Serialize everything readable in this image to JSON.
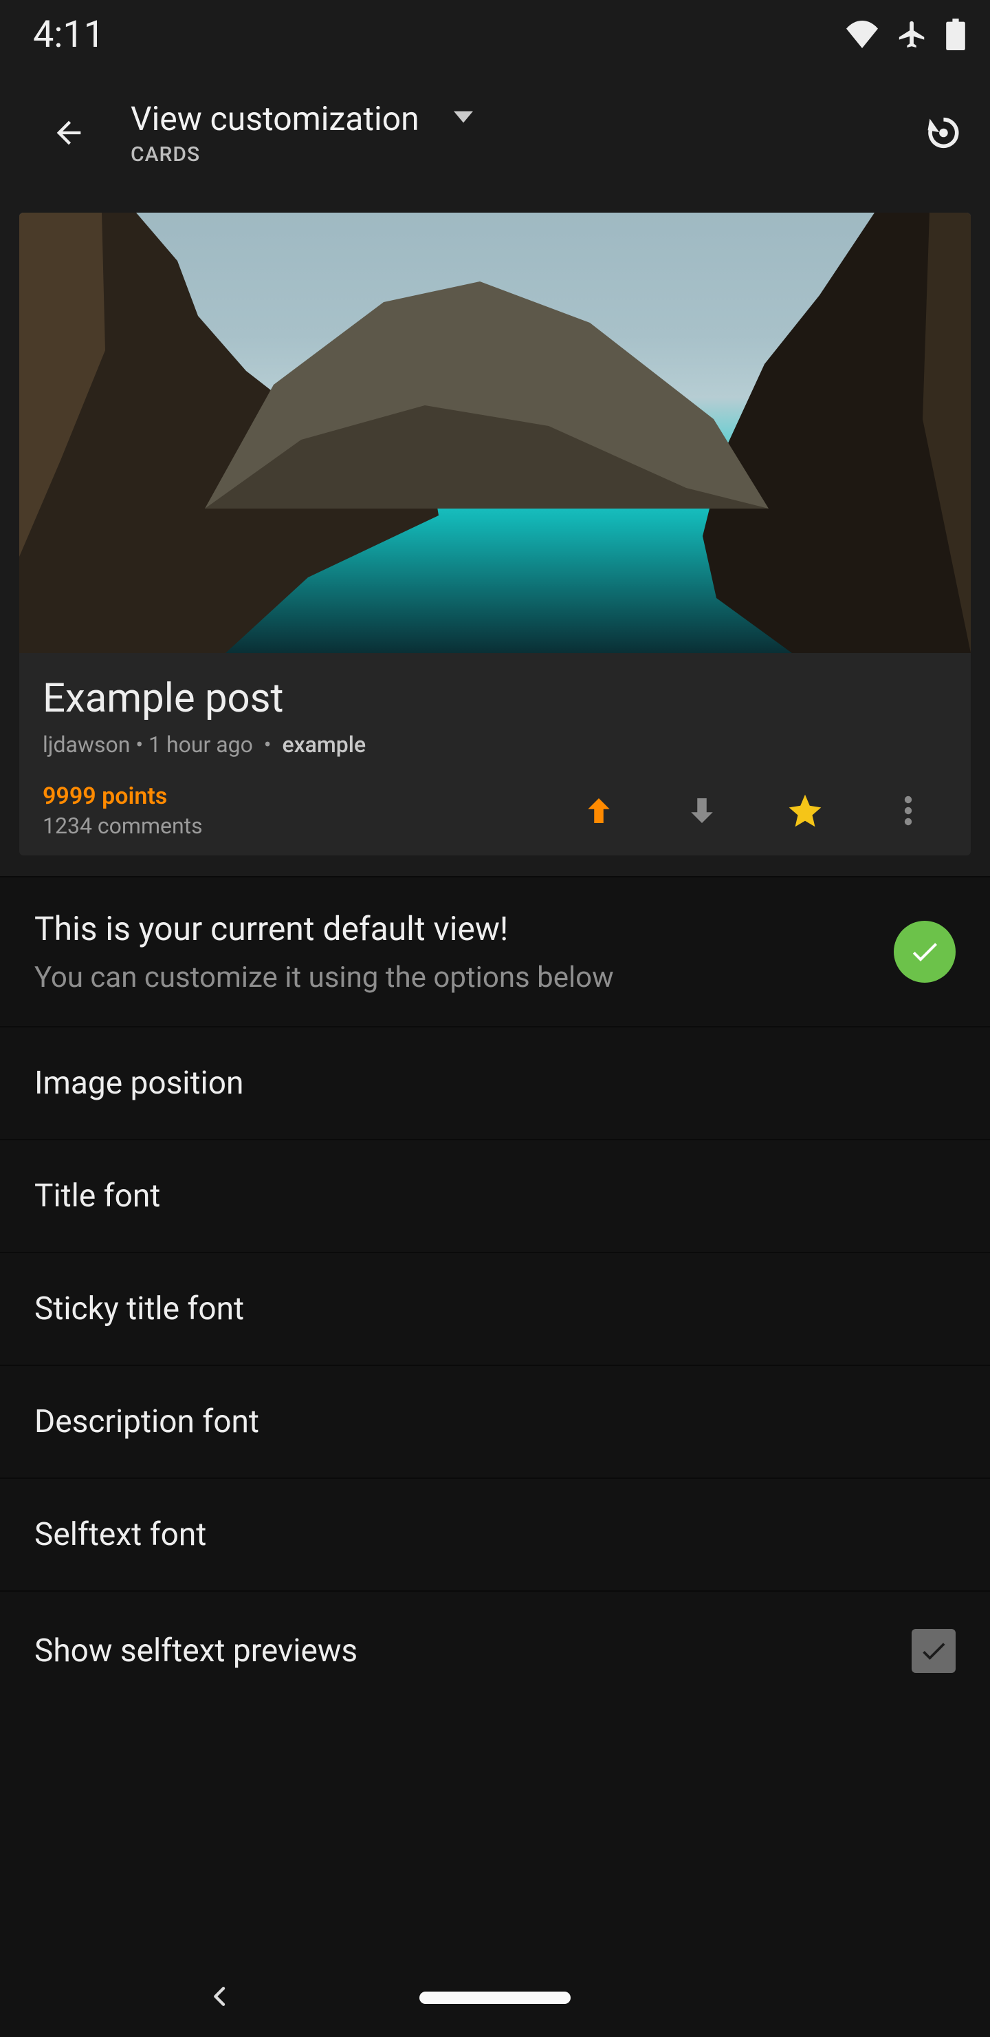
{
  "statusbar": {
    "time": "4:11"
  },
  "appbar": {
    "title": "View customization",
    "subtitle": "CARDS"
  },
  "preview_post": {
    "title": "Example post",
    "author": "ljdawson",
    "age": "1 hour ago",
    "subreddit": "example",
    "points": "9999 points",
    "comments": "1234 comments"
  },
  "banner": {
    "headline": "This is your current default view!",
    "subline": "You can customize it using the options below"
  },
  "options": [
    {
      "label": "Image position"
    },
    {
      "label": "Title font"
    },
    {
      "label": "Sticky title font"
    },
    {
      "label": "Description font"
    },
    {
      "label": "Selftext font"
    },
    {
      "label": "Show selftext previews",
      "checkbox": true,
      "checked": true
    }
  ]
}
